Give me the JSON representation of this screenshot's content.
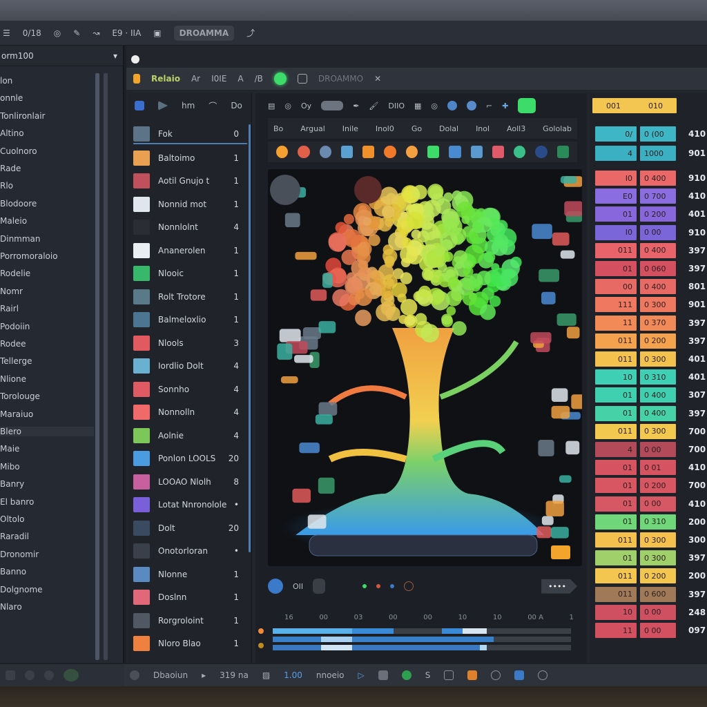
{
  "toolbar": {
    "items": [
      "0/18",
      "◎",
      "✎",
      "↝",
      "E9 · IIA",
      "▣"
    ],
    "pill": "DROAMMA",
    "right_icon": "⤴"
  },
  "left_panel": {
    "title": "orm100",
    "items": [
      "lon",
      "onnle",
      "Tonlironlair",
      "Altino",
      "Cuolnoro",
      "Rade",
      "Rlo",
      "Blodoore",
      "Maleio",
      "Dinmman",
      "Porromoraloio",
      "Rodelie",
      "Nomr",
      "Rairl",
      "Podoiin",
      "Rodee",
      "Tellerge",
      "Nlione",
      "Torolouge",
      "Maraiuo",
      "Blero",
      "Maie",
      "Mibo",
      "Banry",
      "El banro",
      "Oltolo",
      "Raradil",
      "Dronomir",
      "Banno",
      "Dolgnome",
      "Nlaro"
    ]
  },
  "tabbar": {
    "title": "Relaio",
    "items": [
      "Ar",
      "I0IE",
      "A",
      "/B"
    ],
    "tab2": "DROAMMO"
  },
  "list_toolbar": [
    "hm",
    "Do"
  ],
  "list": [
    {
      "label": "Fok",
      "count": "0",
      "color": "#5d7488",
      "selected": true
    },
    {
      "label": "Baltoimo",
      "count": "1",
      "color": "#e9a050"
    },
    {
      "label": "Aotil Gnujo t",
      "count": "1",
      "color": "#c0505c"
    },
    {
      "label": "Nonnid mot",
      "count": "1",
      "color": "#dfe6ee"
    },
    {
      "label": "Nonnlolnt",
      "count": "4",
      "color": "#2a2d33"
    },
    {
      "label": "Ananerolen",
      "count": "1",
      "color": "#e8eef2"
    },
    {
      "label": "Nlooic",
      "count": "1",
      "color": "#38b86a"
    },
    {
      "label": "Rolt Trotore",
      "count": "1",
      "color": "#5a7a8a"
    },
    {
      "label": "Balmeloxlio",
      "count": "1",
      "color": "#4c7592"
    },
    {
      "label": "Nlools",
      "count": "3",
      "color": "#e05a60"
    },
    {
      "label": "Iordlio Dolt",
      "count": "4",
      "color": "#6ab0d0"
    },
    {
      "label": "Sonnho",
      "count": "4",
      "color": "#e05a64"
    },
    {
      "label": "Nonnolln",
      "count": "4",
      "color": "#f06a6a"
    },
    {
      "label": "Aolnie",
      "count": "4",
      "color": "#7cc65a"
    },
    {
      "label": "Ponlon LOOLS",
      "count": "20",
      "color": "#4a9be0"
    },
    {
      "label": "LOOAO Nlolh",
      "count": "8",
      "color": "#c860a0"
    },
    {
      "label": "Lotat Nnronolole",
      "count": "•",
      "color": "#7a60d8"
    },
    {
      "label": "Dolt",
      "count": "20",
      "color": "#3a4a60"
    },
    {
      "label": "Onotorloran",
      "count": "•",
      "color": "#3a404a"
    },
    {
      "label": "Nlonne",
      "count": "1",
      "color": "#5a8ac0"
    },
    {
      "label": "Doslnn",
      "count": "1",
      "color": "#e06878"
    },
    {
      "label": "Rorgroloint",
      "count": "1",
      "color": "#505864"
    },
    {
      "label": "Nloro Blao",
      "count": "1",
      "color": "#f08040"
    }
  ],
  "center": {
    "toolbar": [
      "Oy",
      "DIIO"
    ],
    "tabs": [
      "Bo",
      "Argual",
      "Inile",
      "Inol0",
      "Go",
      "Dolal",
      "Inol",
      "Aoll3",
      "Gololab"
    ],
    "controls": {
      "label": "OII"
    },
    "timeline_labels": [
      "16",
      "00",
      "03",
      "00",
      "00",
      "10",
      "10",
      "00 A",
      "1"
    ]
  },
  "right_panel": {
    "header": {
      "left": "001",
      "right": "010"
    },
    "rows": [
      {
        "a": "0/",
        "b": "0 (00",
        "n": "410",
        "c": "#3fb6c6"
      },
      {
        "a": "4",
        "b": "1000",
        "n": "901",
        "c": "#3ab0c2"
      },
      {
        "a": "I0",
        "b": "0 400",
        "n": "910",
        "c": "#ea6868"
      },
      {
        "a": "E0",
        "b": "0 700",
        "n": "410",
        "c": "#8a6de0"
      },
      {
        "a": "01",
        "b": "0 200",
        "n": "401",
        "c": "#8867dc"
      },
      {
        "a": "I0",
        "b": "0 00",
        "n": "910",
        "c": "#7a66d8"
      },
      {
        "a": "011",
        "b": "0 400",
        "n": "397",
        "c": "#e8646a"
      },
      {
        "a": "01",
        "b": "0 060",
        "n": "397",
        "c": "#d45060"
      },
      {
        "a": "00",
        "b": "0 400",
        "n": "801",
        "c": "#e86a64"
      },
      {
        "a": "111",
        "b": "0 300",
        "n": "901",
        "c": "#ef7860"
      },
      {
        "a": "11",
        "b": "0 370",
        "n": "397",
        "c": "#f28a58"
      },
      {
        "a": "011",
        "b": "0 200",
        "n": "397",
        "c": "#f5a24e"
      },
      {
        "a": "011",
        "b": "0 300",
        "n": "401",
        "c": "#f3c24e"
      },
      {
        "a": "10",
        "b": "0 310",
        "n": "401",
        "c": "#3ecfb4"
      },
      {
        "a": "01",
        "b": "0 400",
        "n": "307",
        "c": "#3fd0b0"
      },
      {
        "a": "01",
        "b": "0 400",
        "n": "397",
        "c": "#46d2a6"
      },
      {
        "a": "011",
        "b": "0 300",
        "n": "700",
        "c": "#f3c84f"
      },
      {
        "a": "4",
        "b": "0 00",
        "n": "700",
        "c": "#b34a5a"
      },
      {
        "a": "01",
        "b": "0 01",
        "n": "410",
        "c": "#d65462"
      },
      {
        "a": "01",
        "b": "0 200",
        "n": "700",
        "c": "#d85662"
      },
      {
        "a": "01",
        "b": "0 00",
        "n": "410",
        "c": "#d55864"
      },
      {
        "a": "01",
        "b": "0 310",
        "n": "200",
        "c": "#6fd67a"
      },
      {
        "a": "011",
        "b": "0 300",
        "n": "300",
        "c": "#f4c04e"
      },
      {
        "a": "01",
        "b": "0 300",
        "n": "397",
        "c": "#9fd06a"
      },
      {
        "a": "011",
        "b": "0 200",
        "n": "200",
        "c": "#f2c64f"
      },
      {
        "a": "011",
        "b": "0 600",
        "n": "397",
        "c": "#a07a58"
      },
      {
        "a": "10",
        "b": "0 00",
        "n": "248",
        "c": "#cf5060"
      },
      {
        "a": "11",
        "b": "0 00",
        "n": "097",
        "c": "#d2505f"
      }
    ]
  },
  "bottombar": {
    "items": [
      "Dbaoiun",
      "319 na",
      "1.00",
      "nnoeio"
    ]
  },
  "colors": {
    "accent_green": "#3ddc6a",
    "selection": "#4d7fb3",
    "timeline_blue": "#3d8fd8"
  }
}
